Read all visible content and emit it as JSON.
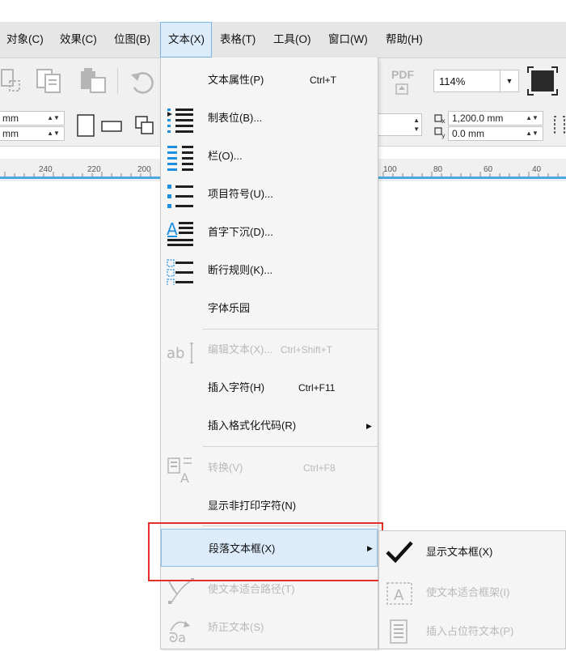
{
  "menubar": {
    "items": [
      {
        "label": "对象(C)"
      },
      {
        "label": "效果(C)"
      },
      {
        "label": "位图(B)"
      },
      {
        "label": "文本(X)"
      },
      {
        "label": "表格(T)"
      },
      {
        "label": "工具(O)"
      },
      {
        "label": "窗口(W)"
      },
      {
        "label": "帮助(H)"
      }
    ]
  },
  "toolbar": {
    "pdf_label": "PDF",
    "zoom_value": "114%"
  },
  "propertybar": {
    "width_unit": "mm",
    "height_unit": "mm",
    "x_value": "1,200.0 mm",
    "y_value": "0.0 mm"
  },
  "ruler": {
    "ticks": [
      "240",
      "220",
      "200",
      "100",
      "80",
      "60",
      "40"
    ]
  },
  "text_menu": {
    "items": [
      {
        "label": "文本属性(P)",
        "shortcut": "Ctrl+T"
      },
      {
        "label": "制表位(B)..."
      },
      {
        "label": "栏(O)..."
      },
      {
        "label": "项目符号(U)..."
      },
      {
        "label": "首字下沉(D)..."
      },
      {
        "label": "断行规则(K)..."
      },
      {
        "label": "字体乐园"
      },
      {
        "label": "编辑文本(X)...",
        "shortcut": "Ctrl+Shift+T"
      },
      {
        "label": "插入字符(H)",
        "shortcut": "Ctrl+F11"
      },
      {
        "label": "插入格式化代码(R)"
      },
      {
        "label": "转换(V)",
        "shortcut": "Ctrl+F8"
      },
      {
        "label": "显示非打印字符(N)"
      },
      {
        "label": "段落文本框(X)"
      },
      {
        "label": "使文本适合路径(T)"
      },
      {
        "label": "矫正文本(S)"
      }
    ]
  },
  "submenu": {
    "items": [
      {
        "label": "显示文本框(X)"
      },
      {
        "label": "使文本适合框架(I)"
      },
      {
        "label": "插入占位符文本(P)"
      }
    ]
  },
  "colors": {
    "accent": "#1e90e0",
    "highlight": "#dcecfa",
    "annotation_red": "#e2312b"
  }
}
